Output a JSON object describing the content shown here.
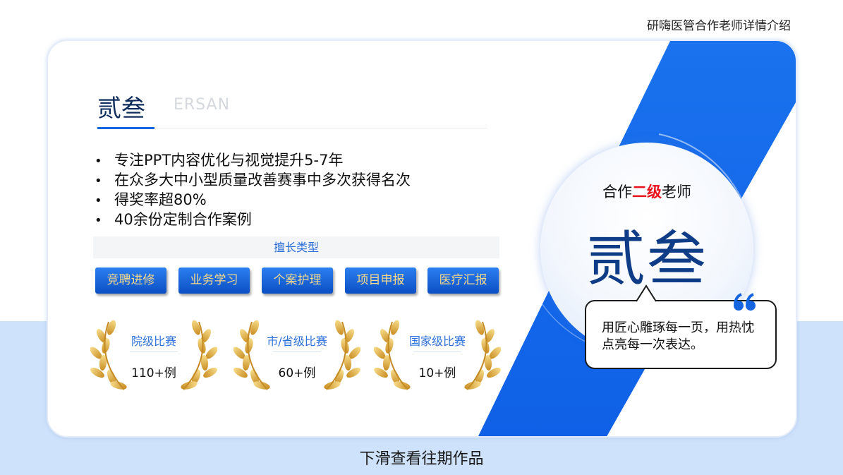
{
  "header": {
    "caption": "研嗨医管合作老师详情介绍"
  },
  "profile": {
    "name": "贰叁",
    "name_en": "ERSAN",
    "bullets": [
      "专注PPT内容优化与视觉提升5-7年",
      "在众多大中小型质量改善赛事中多次获得名次",
      "得奖率超80%",
      "40余份定制合作案例"
    ],
    "bullet_marker": "•"
  },
  "skills": {
    "heading": "擅长类型",
    "tags": [
      "竞聘进修",
      "业务学习",
      "个案护理",
      "项目申报",
      "医疗汇报"
    ]
  },
  "awards": [
    {
      "title": "院级比赛",
      "count": "110+例"
    },
    {
      "title": "市/省级比赛",
      "count": "60+例"
    },
    {
      "title": "国家级比赛",
      "count": "10+例"
    }
  ],
  "badge": {
    "subtitle_pre": "合作",
    "subtitle_highlight": "二级",
    "subtitle_post": "老师",
    "name": "贰叁"
  },
  "quote": {
    "text": "用匠心雕琢每一页，用热忱点亮每一次表达。",
    "icon": "quote-icon"
  },
  "footer": {
    "caption": "下滑查看往期作品"
  },
  "colors": {
    "accent_blue": "#1565e0",
    "highlight_red": "#e8131b",
    "tag_text_gold": "#f5d98c",
    "band_light_blue": "#cfe2fb"
  }
}
